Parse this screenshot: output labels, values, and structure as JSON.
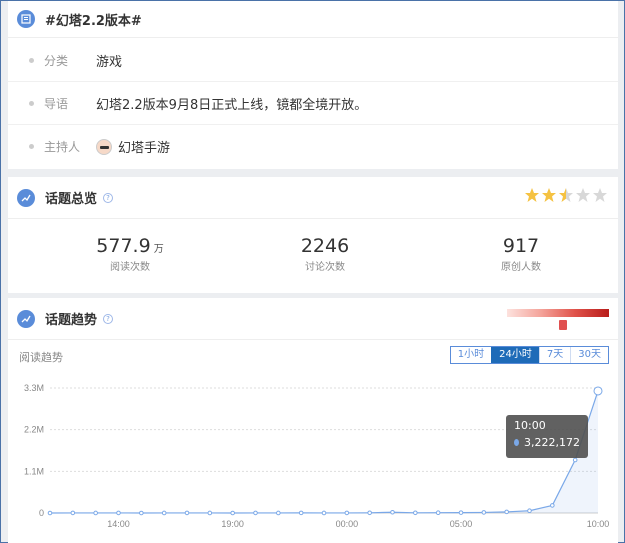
{
  "topic": {
    "title": "#幻塔2.2版本#",
    "rows": [
      {
        "label": "分类",
        "value": "游戏"
      },
      {
        "label": "导语",
        "value": "幻塔2.2版本9月8日正式上线，镜都全境开放。"
      },
      {
        "label": "主持人",
        "value": "幻塔手游"
      }
    ]
  },
  "overview": {
    "title": "话题总览",
    "help": "?",
    "rating": 2.5,
    "stats": [
      {
        "value": "577.9",
        "unit": "万",
        "label": "阅读次数"
      },
      {
        "value": "2246",
        "unit": "",
        "label": "讨论次数"
      },
      {
        "value": "917",
        "unit": "",
        "label": "原创人数"
      }
    ]
  },
  "trend": {
    "title": "话题趋势",
    "help": "?",
    "heat_level": 0.55,
    "subtitle": "阅读趋势",
    "ranges": [
      {
        "label": "1小时",
        "active": false
      },
      {
        "label": "24小时",
        "active": true
      },
      {
        "label": "7天",
        "active": false
      },
      {
        "label": "30天",
        "active": false
      }
    ],
    "tooltip": {
      "time": "10:00",
      "value": "3,222,172"
    }
  },
  "colors": {
    "accent": "#5a8cd9",
    "active_tab": "#1e6bb8",
    "line": "#7aa8e8",
    "star": "#f5c242"
  },
  "chart_data": {
    "type": "line",
    "ylim": [
      0,
      3300000
    ],
    "yticks": [
      {
        "label": "3.3M",
        "value": 3300000
      },
      {
        "label": "2.2M",
        "value": 2200000
      },
      {
        "label": "1.1M",
        "value": 1100000
      },
      {
        "label": "0",
        "value": 0
      }
    ],
    "xticks": [
      "14:00",
      "19:00",
      "00:00",
      "05:00",
      "10:00"
    ],
    "series": [
      {
        "values": [
          0,
          2000,
          1000,
          2000,
          0,
          1000,
          2000,
          1000,
          0,
          2000,
          1000,
          3000,
          1000,
          2000,
          5000,
          20000,
          5000,
          8000,
          10000,
          15000,
          30000,
          60000,
          200000,
          1400000,
          3222172
        ]
      }
    ]
  }
}
